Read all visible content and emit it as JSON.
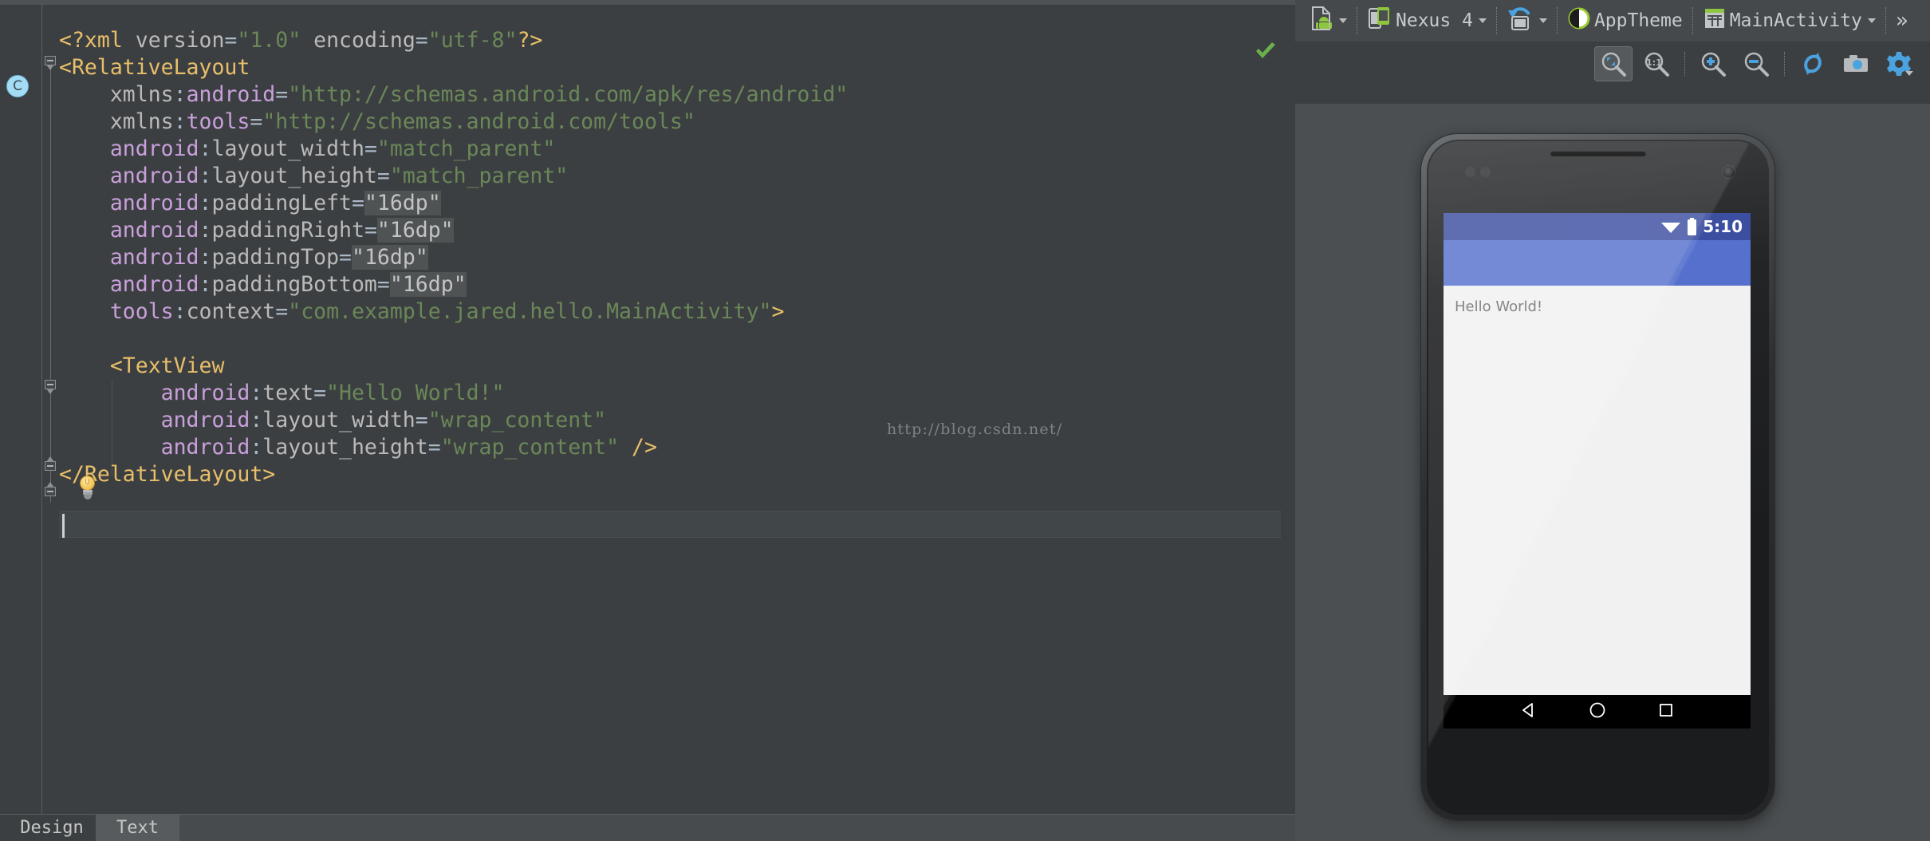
{
  "editor": {
    "gutter": {
      "badge_label": "C"
    },
    "status_ok_icon": "green-checkmark-icon",
    "watermark": "http://blog.csdn.net/",
    "code_lines": [
      {
        "indent": 0,
        "tokens": [
          {
            "t": "<?xml ",
            "c": "tag"
          },
          {
            "t": "version",
            "c": "attr"
          },
          {
            "t": "=",
            "c": "punc"
          },
          {
            "t": "\"1.0\"",
            "c": "str"
          },
          {
            "t": " ",
            "c": "plain"
          },
          {
            "t": "encoding",
            "c": "attr"
          },
          {
            "t": "=",
            "c": "punc"
          },
          {
            "t": "\"utf-8\"",
            "c": "str"
          },
          {
            "t": "?>",
            "c": "tag"
          }
        ]
      },
      {
        "indent": 0,
        "tokens": [
          {
            "t": "<RelativeLayout",
            "c": "tag"
          }
        ]
      },
      {
        "indent": 0,
        "tokens": [
          {
            "t": "    ",
            "c": "plain"
          },
          {
            "t": "xmlns",
            "c": "attr"
          },
          {
            "t": ":",
            "c": "punc"
          },
          {
            "t": "android",
            "c": "ns"
          },
          {
            "t": "=",
            "c": "punc"
          },
          {
            "t": "\"http://schemas.android.com/apk/res/android\"",
            "c": "str"
          }
        ]
      },
      {
        "indent": 0,
        "tokens": [
          {
            "t": "    ",
            "c": "plain"
          },
          {
            "t": "xmlns",
            "c": "attr"
          },
          {
            "t": ":",
            "c": "punc"
          },
          {
            "t": "tools",
            "c": "ns"
          },
          {
            "t": "=",
            "c": "punc"
          },
          {
            "t": "\"http://schemas.android.com/tools\"",
            "c": "str"
          }
        ]
      },
      {
        "indent": 0,
        "tokens": [
          {
            "t": "    ",
            "c": "plain"
          },
          {
            "t": "android",
            "c": "ns"
          },
          {
            "t": ":",
            "c": "punc"
          },
          {
            "t": "layout_width",
            "c": "attr"
          },
          {
            "t": "=",
            "c": "punc"
          },
          {
            "t": "\"match_parent\"",
            "c": "str"
          }
        ]
      },
      {
        "indent": 0,
        "tokens": [
          {
            "t": "    ",
            "c": "plain"
          },
          {
            "t": "android",
            "c": "ns"
          },
          {
            "t": ":",
            "c": "punc"
          },
          {
            "t": "layout_height",
            "c": "attr"
          },
          {
            "t": "=",
            "c": "punc"
          },
          {
            "t": "\"match_parent\"",
            "c": "str"
          }
        ]
      },
      {
        "indent": 0,
        "tokens": [
          {
            "t": "    ",
            "c": "plain"
          },
          {
            "t": "android",
            "c": "ns"
          },
          {
            "t": ":",
            "c": "punc"
          },
          {
            "t": "paddingLeft",
            "c": "attr"
          },
          {
            "t": "=",
            "c": "punc"
          },
          {
            "t": "\"16dp\"",
            "c": "hl"
          }
        ]
      },
      {
        "indent": 0,
        "tokens": [
          {
            "t": "    ",
            "c": "plain"
          },
          {
            "t": "android",
            "c": "ns"
          },
          {
            "t": ":",
            "c": "punc"
          },
          {
            "t": "paddingRight",
            "c": "attr"
          },
          {
            "t": "=",
            "c": "punc"
          },
          {
            "t": "\"16dp\"",
            "c": "hl"
          }
        ]
      },
      {
        "indent": 0,
        "tokens": [
          {
            "t": "    ",
            "c": "plain"
          },
          {
            "t": "android",
            "c": "ns"
          },
          {
            "t": ":",
            "c": "punc"
          },
          {
            "t": "paddingTop",
            "c": "attr"
          },
          {
            "t": "=",
            "c": "punc"
          },
          {
            "t": "\"16dp\"",
            "c": "hl"
          }
        ]
      },
      {
        "indent": 0,
        "tokens": [
          {
            "t": "    ",
            "c": "plain"
          },
          {
            "t": "android",
            "c": "ns"
          },
          {
            "t": ":",
            "c": "punc"
          },
          {
            "t": "paddingBottom",
            "c": "attr"
          },
          {
            "t": "=",
            "c": "punc"
          },
          {
            "t": "\"16dp\"",
            "c": "hl"
          }
        ]
      },
      {
        "indent": 0,
        "tokens": [
          {
            "t": "    ",
            "c": "plain"
          },
          {
            "t": "tools",
            "c": "ns"
          },
          {
            "t": ":",
            "c": "punc"
          },
          {
            "t": "context",
            "c": "attr"
          },
          {
            "t": "=",
            "c": "punc"
          },
          {
            "t": "\"com.example.jared.hello.MainActivity\"",
            "c": "str"
          },
          {
            "t": ">",
            "c": "tag"
          }
        ]
      },
      {
        "indent": 0,
        "tokens": []
      },
      {
        "indent": 0,
        "tokens": [
          {
            "t": "    ",
            "c": "plain"
          },
          {
            "t": "<TextView",
            "c": "tag"
          }
        ]
      },
      {
        "indent": 0,
        "tokens": [
          {
            "t": "        ",
            "c": "plain"
          },
          {
            "t": "android",
            "c": "ns"
          },
          {
            "t": ":",
            "c": "punc"
          },
          {
            "t": "text",
            "c": "attr"
          },
          {
            "t": "=",
            "c": "punc"
          },
          {
            "t": "\"Hello World!\"",
            "c": "str"
          }
        ]
      },
      {
        "indent": 0,
        "tokens": [
          {
            "t": "        ",
            "c": "plain"
          },
          {
            "t": "android",
            "c": "ns"
          },
          {
            "t": ":",
            "c": "punc"
          },
          {
            "t": "layout_width",
            "c": "attr"
          },
          {
            "t": "=",
            "c": "punc"
          },
          {
            "t": "\"wrap_content\"",
            "c": "str"
          }
        ]
      },
      {
        "indent": 0,
        "tokens": [
          {
            "t": "        ",
            "c": "plain"
          },
          {
            "t": "android",
            "c": "ns"
          },
          {
            "t": ":",
            "c": "punc"
          },
          {
            "t": "layout_height",
            "c": "attr"
          },
          {
            "t": "=",
            "c": "punc"
          },
          {
            "t": "\"wrap_content\"",
            "c": "str"
          },
          {
            "t": " ",
            "c": "plain"
          },
          {
            "t": "/>",
            "c": "tag"
          }
        ]
      },
      {
        "indent": 0,
        "tokens": [
          {
            "t": "</RelativeLayout>",
            "c": "tag"
          }
        ]
      },
      {
        "indent": 0,
        "tokens": []
      }
    ]
  },
  "bottom_tabs": {
    "design_label": "Design",
    "text_label": "Text",
    "active": "Text"
  },
  "preview": {
    "toolbar": {
      "layout_variants_label": "",
      "device_label": "Nexus 4",
      "orientation_label": "",
      "theme_label": "AppTheme",
      "activity_label": "MainActivity",
      "overflow_label": "»"
    },
    "zoom_toolbar": {
      "fit_label": "fit-to-screen",
      "actual_label": "1:1",
      "zoom_in_label": "zoom-in",
      "zoom_out_label": "zoom-out",
      "refresh_label": "refresh",
      "screenshot_label": "screenshot",
      "settings_label": "settings"
    },
    "device_screen": {
      "status_time": "5:10",
      "hello_text": "Hello World!",
      "statusbar_color": "#3b4ea0",
      "appbar_color": "#5570cd",
      "content_color": "#f1f1f1",
      "navbar_color": "#000000"
    }
  },
  "colors": {
    "editor_bg": "#3c3f41",
    "tag": "#e8bf6a",
    "string": "#6a8759",
    "namespace": "#c9a0dc",
    "attribute": "#bababa",
    "highlight": "#4f5354",
    "accent_blue": "#57a1d4",
    "ok_green": "#6ab04c"
  }
}
